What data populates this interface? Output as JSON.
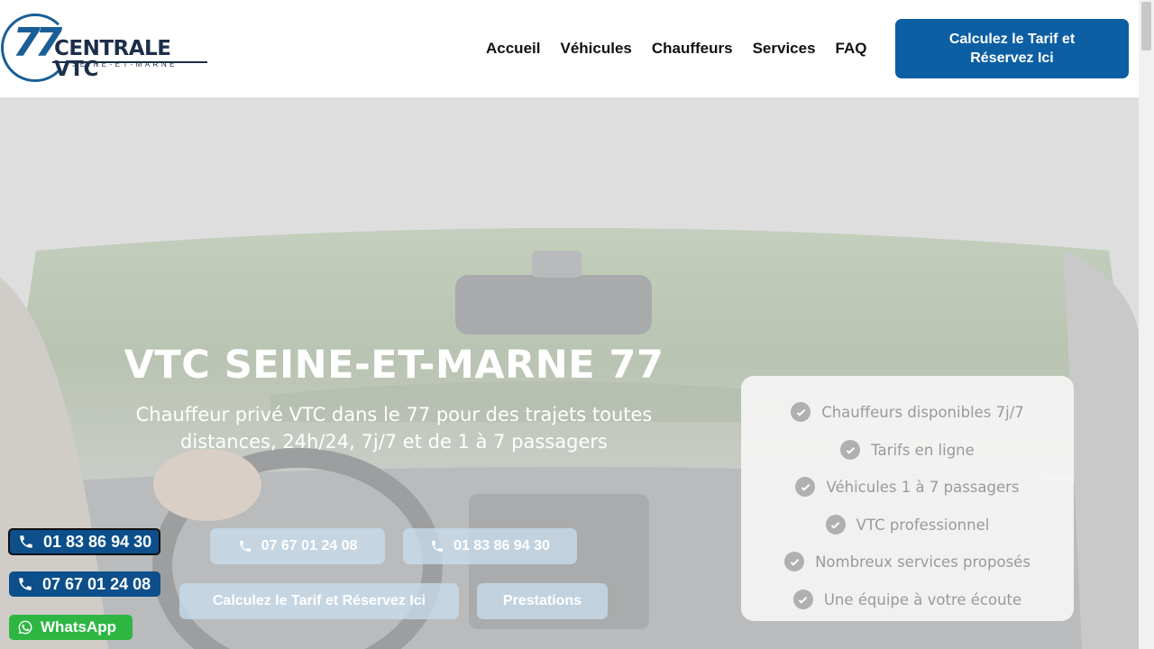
{
  "logo": {
    "number": "77",
    "name": "CENTRALE VTC",
    "tagline": "SEINE-ET-MARNE"
  },
  "nav": [
    "Accueil",
    "Véhicules",
    "Chauffeurs",
    "Services",
    "FAQ"
  ],
  "header_cta": "Calculez le Tarif et Réservez Ici",
  "hero": {
    "title": "VTC SEINE-ET-MARNE 77",
    "subtitle": "Chauffeur privé VTC dans le 77 pour des trajets toutes distances, 24h/24, 7j/7 et de 1 à 7 passagers",
    "phone1": "07 67 01 24 08",
    "phone2": "01 83 86 94 30",
    "cta_tarif": "Calculez le Tarif et Réservez Ici",
    "cta_prestations": "Prestations"
  },
  "features": [
    "Chauffeurs disponibles 7j/7",
    "Tarifs en ligne",
    "Véhicules 1 à 7 passagers",
    "VTC professionnel",
    "Nombreux services proposés",
    "Une équipe à votre écoute"
  ],
  "floating": {
    "phone1": "01 83 86 94 30",
    "phone2": "07 67 01 24 08",
    "whatsapp": "WhatsApp"
  },
  "colors": {
    "brand_blue": "#0c5fa3",
    "whatsapp_green": "#2db742"
  }
}
